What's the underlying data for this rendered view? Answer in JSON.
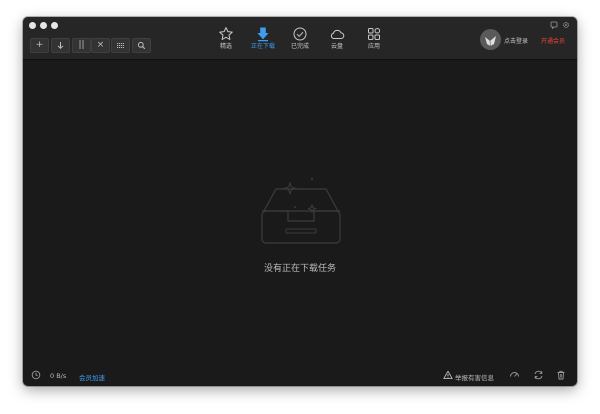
{
  "nav": {
    "items": [
      {
        "label": "精选",
        "icon": "star-icon"
      },
      {
        "label": "正在下载",
        "icon": "download-arrow-icon"
      },
      {
        "label": "已完成",
        "icon": "check-circle-icon"
      },
      {
        "label": "云盘",
        "icon": "cloud-icon"
      },
      {
        "label": "应用",
        "icon": "apps-icon"
      }
    ]
  },
  "toolbar": {
    "new_label": "+",
    "pause_label": "||",
    "delete_label": "×"
  },
  "user": {
    "login_label": "点击登录",
    "vip_label": "开通会员"
  },
  "main": {
    "empty_message": "没有正在下载任务"
  },
  "statusbar": {
    "speed": "0 B/s",
    "accelerate_label": "会员加速",
    "report_label": "举报有害信息"
  },
  "colors": {
    "accent": "#3d9df0",
    "vip": "#e8443a",
    "background": "#1a1a1a",
    "titlebar": "#262626"
  }
}
